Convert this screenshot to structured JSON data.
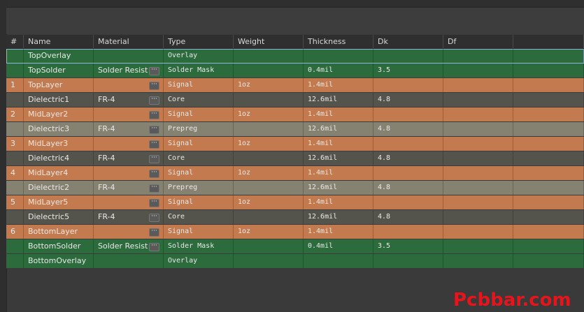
{
  "columns": [
    "#",
    "Name",
    "Material",
    "Type",
    "Weight",
    "Thickness",
    "Dk",
    "Df"
  ],
  "rows": [
    {
      "num": "",
      "name": "TopOverlay",
      "material": "",
      "type": "Overlay",
      "weight": "",
      "thickness": "",
      "dk": "",
      "df": "",
      "style": "green",
      "has_dots": false,
      "selected": true
    },
    {
      "num": "",
      "name": "TopSolder",
      "material": "Solder Resist",
      "type": "Solder Mask",
      "weight": "",
      "thickness": "0.4mil",
      "dk": "3.5",
      "df": "",
      "style": "green",
      "has_dots": true,
      "selected": false
    },
    {
      "num": "1",
      "name": "TopLayer",
      "material": "",
      "type": "Signal",
      "weight": "1oz",
      "thickness": "1.4mil",
      "dk": "",
      "df": "",
      "style": "orange",
      "has_dots": true,
      "selected": false
    },
    {
      "num": "",
      "name": "Dielectric1",
      "material": "FR-4",
      "type": "Core",
      "weight": "",
      "thickness": "12.6mil",
      "dk": "4.8",
      "df": "",
      "style": "dark",
      "has_dots": true,
      "selected": false
    },
    {
      "num": "2",
      "name": "MidLayer2",
      "material": "",
      "type": "Signal",
      "weight": "1oz",
      "thickness": "1.4mil",
      "dk": "",
      "df": "",
      "style": "orange",
      "has_dots": true,
      "selected": false
    },
    {
      "num": "",
      "name": "Dielectric3",
      "material": "FR-4",
      "type": "Prepreg",
      "weight": "",
      "thickness": "12.6mil",
      "dk": "4.8",
      "df": "",
      "style": "gray",
      "has_dots": true,
      "selected": false
    },
    {
      "num": "3",
      "name": "MidLayer3",
      "material": "",
      "type": "Signal",
      "weight": "1oz",
      "thickness": "1.4mil",
      "dk": "",
      "df": "",
      "style": "orange",
      "has_dots": true,
      "selected": false
    },
    {
      "num": "",
      "name": "Dielectric4",
      "material": "FR-4",
      "type": "Core",
      "weight": "",
      "thickness": "12.6mil",
      "dk": "4.8",
      "df": "",
      "style": "dark",
      "has_dots": true,
      "selected": false
    },
    {
      "num": "4",
      "name": "MidLayer4",
      "material": "",
      "type": "Signal",
      "weight": "1oz",
      "thickness": "1.4mil",
      "dk": "",
      "df": "",
      "style": "orange",
      "has_dots": true,
      "selected": false
    },
    {
      "num": "",
      "name": "Dielectric2",
      "material": "FR-4",
      "type": "Prepreg",
      "weight": "",
      "thickness": "12.6mil",
      "dk": "4.8",
      "df": "",
      "style": "gray",
      "has_dots": true,
      "selected": false
    },
    {
      "num": "5",
      "name": "MidLayer5",
      "material": "",
      "type": "Signal",
      "weight": "1oz",
      "thickness": "1.4mil",
      "dk": "",
      "df": "",
      "style": "orange",
      "has_dots": true,
      "selected": false
    },
    {
      "num": "",
      "name": "Dielectric5",
      "material": "FR-4",
      "type": "Core",
      "weight": "",
      "thickness": "12.6mil",
      "dk": "4.8",
      "df": "",
      "style": "dark",
      "has_dots": true,
      "selected": false
    },
    {
      "num": "6",
      "name": "BottomLayer",
      "material": "",
      "type": "Signal",
      "weight": "1oz",
      "thickness": "1.4mil",
      "dk": "",
      "df": "",
      "style": "orange",
      "has_dots": true,
      "selected": false
    },
    {
      "num": "",
      "name": "BottomSolder",
      "material": "Solder Resist",
      "type": "Solder Mask",
      "weight": "",
      "thickness": "0.4mil",
      "dk": "3.5",
      "df": "",
      "style": "green",
      "has_dots": true,
      "selected": false
    },
    {
      "num": "",
      "name": "BottomOverlay",
      "material": "",
      "type": "Overlay",
      "weight": "",
      "thickness": "",
      "dk": "",
      "df": "",
      "style": "green",
      "has_dots": false,
      "selected": false
    }
  ],
  "material_button_label": "···",
  "watermark": "Pcbbar.com",
  "colors": {
    "green_row": "#2b6b3c",
    "orange_row": "#c27a4e",
    "dark_row": "#55544c",
    "gray_row": "#868271",
    "watermark": "#e8131b"
  }
}
